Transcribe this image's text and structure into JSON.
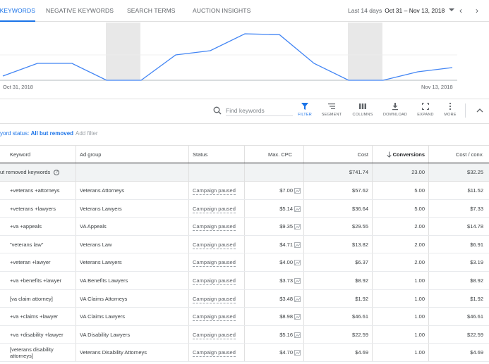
{
  "tabs": [
    {
      "label": "KEYWORDS",
      "active": true
    },
    {
      "label": "NEGATIVE KEYWORDS",
      "active": false
    },
    {
      "label": "SEARCH TERMS",
      "active": false
    },
    {
      "label": "AUCTION INSIGHTS",
      "active": false
    }
  ],
  "daterange": {
    "label": "Last 14 days",
    "value": "Oct 31 – Nov 13, 2018"
  },
  "chart": {
    "start_label": "Oct 31, 2018",
    "end_label": "Nov 13, 2018"
  },
  "chart_data": {
    "type": "line",
    "x": [
      "Oct 31",
      "Nov 1",
      "Nov 2",
      "Nov 3",
      "Nov 4",
      "Nov 5",
      "Nov 6",
      "Nov 7",
      "Nov 8",
      "Nov 9",
      "Nov 10",
      "Nov 11",
      "Nov 12",
      "Nov 13"
    ],
    "series": [
      {
        "values": [
          0.5,
          2,
          2,
          0,
          0,
          3,
          3.5,
          5.5,
          5.4,
          2,
          0,
          0,
          1,
          1.5
        ]
      }
    ],
    "shaded_days": [
      "Nov 3",
      "Nov 10"
    ],
    "color": "#4285f4"
  },
  "toolbar": {
    "search_placeholder": "Find keywords",
    "buttons": [
      {
        "label": "FILTER",
        "icon": "filter-icon"
      },
      {
        "label": "SEGMENT",
        "icon": "segment-icon"
      },
      {
        "label": "COLUMNS",
        "icon": "columns-icon"
      },
      {
        "label": "DOWNLOAD",
        "icon": "download-icon"
      },
      {
        "label": "EXPAND",
        "icon": "expand-icon"
      },
      {
        "label": "MORE",
        "icon": "more-vert-icon"
      }
    ]
  },
  "filter": {
    "prefix": "yord status: ",
    "value": "All but removed",
    "add_label": "Add filter"
  },
  "table": {
    "headers": {
      "keyword": "Keyword",
      "ad_group": "Ad group",
      "status": "Status",
      "max_cpc": "Max. CPC",
      "cost": "Cost",
      "conversions": "Conversions",
      "cost_conv": "Cost / conv."
    },
    "total": {
      "label": "ut removed keywords",
      "cost": "$741.74",
      "conversions": "23.00",
      "cost_conv": "$32.25"
    },
    "rows": [
      {
        "keyword": "+veterans +attorneys",
        "ad_group": "Veterans Attorneys",
        "status": "Campaign paused",
        "max_cpc": "$7.00",
        "cost": "$57.62",
        "conversions": "5.00",
        "cost_conv": "$11.52"
      },
      {
        "keyword": "+veterans +lawyers",
        "ad_group": "Veterans Lawyers",
        "status": "Campaign paused",
        "max_cpc": "$5.14",
        "cost": "$36.64",
        "conversions": "5.00",
        "cost_conv": "$7.33"
      },
      {
        "keyword": "+va +appeals",
        "ad_group": "VA Appeals",
        "status": "Campaign paused",
        "max_cpc": "$9.35",
        "cost": "$29.55",
        "conversions": "2.00",
        "cost_conv": "$14.78"
      },
      {
        "keyword": "\"veterans law\"",
        "ad_group": "Veterans Law",
        "status": "Campaign paused",
        "max_cpc": "$4.71",
        "cost": "$13.82",
        "conversions": "2.00",
        "cost_conv": "$6.91"
      },
      {
        "keyword": "+veteran +lawyer",
        "ad_group": "Veterans Lawyers",
        "status": "Campaign paused",
        "max_cpc": "$4.00",
        "cost": "$6.37",
        "conversions": "2.00",
        "cost_conv": "$3.19"
      },
      {
        "keyword": "+va +benefits +lawyer",
        "ad_group": "VA Benefits Lawyers",
        "status": "Campaign paused",
        "max_cpc": "$3.73",
        "cost": "$8.92",
        "conversions": "1.00",
        "cost_conv": "$8.92"
      },
      {
        "keyword": "[va claim attorney]",
        "ad_group": "VA Claims Attorneys",
        "status": "Campaign paused",
        "max_cpc": "$3.48",
        "cost": "$1.92",
        "conversions": "1.00",
        "cost_conv": "$1.92"
      },
      {
        "keyword": "+va +claims +lawyer",
        "ad_group": "VA Claims Lawyers",
        "status": "Campaign paused",
        "max_cpc": "$8.98",
        "cost": "$46.61",
        "conversions": "1.00",
        "cost_conv": "$46.61"
      },
      {
        "keyword": "+va +disability +lawyer",
        "ad_group": "VA Disability Lawyers",
        "status": "Campaign paused",
        "max_cpc": "$5.16",
        "cost": "$22.59",
        "conversions": "1.00",
        "cost_conv": "$22.59"
      },
      {
        "keyword": "[veterans disability attorneys]",
        "ad_group": "Veterans Disability Attorneys",
        "status": "Campaign paused",
        "max_cpc": "$4.70",
        "cost": "$4.69",
        "conversions": "1.00",
        "cost_conv": "$4.69"
      }
    ]
  }
}
